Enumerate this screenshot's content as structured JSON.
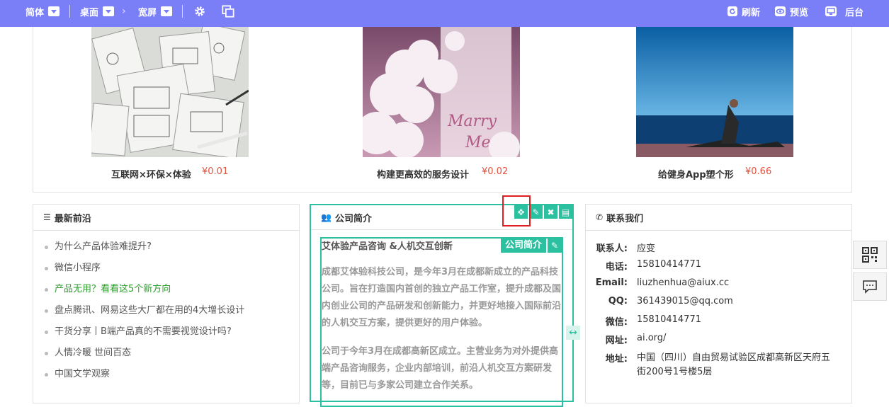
{
  "toolbar": {
    "lang_label": "简体",
    "view_label": "桌面",
    "width_label": "宽屏",
    "refresh_label": "刷新",
    "preview_label": "预览",
    "admin_label": "后台",
    "bg_color": "#7a7ff8"
  },
  "products": [
    {
      "name": "互联网×环保×体验",
      "price": "¥0.01"
    },
    {
      "name": "构建更高效的服务设计",
      "price": "¥0.02"
    },
    {
      "name": "给健身App塑个形",
      "price": "¥0.66"
    }
  ],
  "news": {
    "title": "最新前沿",
    "items": [
      "为什么产品体验难提升?",
      "微信小程序",
      "产品无用？看看这5个新方向",
      "盘点腾讯、网易这些大厂都在用的4大增长设计",
      "干货分享丨B端产品真的不需要视觉设计吗?",
      "人情冷暖 世间百态",
      "中国文学观察"
    ]
  },
  "intro": {
    "title": "公司简介",
    "module_tag": "公司简介",
    "heading": "艾体验产品咨询 &人机交互创新",
    "para1": "成都艾体验科技公司，是今年3月在成都新成立的产品科技公司。旨在打造国内首创的独立产品工作室，提升成都及国内创业公司的产品研发和创新能力，并更好地接入国际前沿的人机交互方案，提供更好的用户体验。",
    "para2": "公司于今年3月在成都高新区成立。主营业务为对外提供高端产品咨询服务，企业内部培训，前沿人机交互方案研发等，目前已与多家公司建立合作关系。",
    "accent_color": "#2bc0a0"
  },
  "contact": {
    "title": "联系我们",
    "rows": [
      {
        "k": "联系人:",
        "v": "应变"
      },
      {
        "k": "电话:",
        "v": "15810414771"
      },
      {
        "k": "Email:",
        "v": "liuzhenhua@aiux.cc"
      },
      {
        "k": "QQ:",
        "v": "361439015@qq.com"
      },
      {
        "k": "微信:",
        "v": "15810414771"
      },
      {
        "k": "网址:",
        "v": "ai.org/"
      },
      {
        "k": "地址:",
        "v": "中国（四川）自由贸易试验区成都高新区天府五街200号1号楼5层"
      }
    ]
  }
}
